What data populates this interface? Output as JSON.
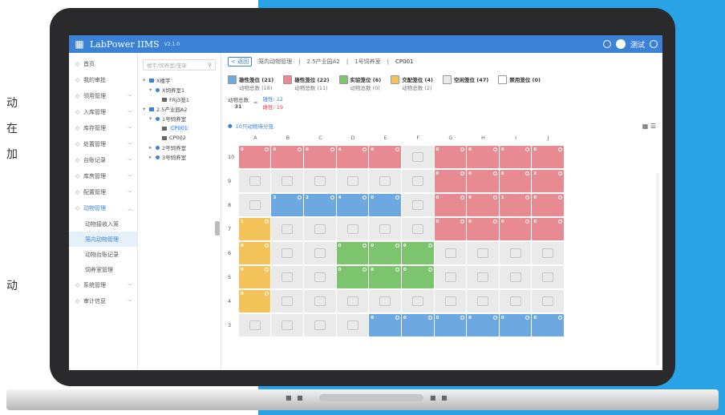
{
  "left_text": [
    "动",
    "在",
    "加",
    "动"
  ],
  "app": {
    "logo": "LabPower IIMS",
    "version": "V2.1.0",
    "user": "测试"
  },
  "sidebar": {
    "items": [
      {
        "icon": "home-icon",
        "label": "首页",
        "expandable": false
      },
      {
        "icon": "approval-icon",
        "label": "我的审批",
        "expandable": false
      },
      {
        "icon": "purchase-icon",
        "label": "领用管理",
        "expandable": true
      },
      {
        "icon": "inbound-icon",
        "label": "入库管理",
        "expandable": true
      },
      {
        "icon": "stock-icon",
        "label": "库存管理",
        "expandable": true
      },
      {
        "icon": "dispose-icon",
        "label": "处置管理",
        "expandable": true
      },
      {
        "icon": "ledger-icon",
        "label": "台账记录",
        "expandable": true
      },
      {
        "icon": "warehouse-icon",
        "label": "库房管理",
        "expandable": true
      },
      {
        "icon": "config-icon",
        "label": "配置管理",
        "expandable": true
      },
      {
        "icon": "animal-icon",
        "label": "动物管理",
        "expandable": true,
        "active": true
      }
    ],
    "subitems": [
      "动物接收入笼",
      "笼内动物管理",
      "动物台账记录",
      "饲养室管理"
    ],
    "selected_sub": 1,
    "items_after": [
      {
        "icon": "system-icon",
        "label": "系统管理",
        "expandable": true
      },
      {
        "icon": "audit-icon",
        "label": "审计信息",
        "expandable": true
      }
    ]
  },
  "tree": {
    "search_placeholder": "楼宇/饲养室/笼架",
    "nodes": [
      {
        "level": 0,
        "label": "X楼宇",
        "twist": "▾",
        "type": "bld"
      },
      {
        "level": 1,
        "label": "X饲养室1",
        "twist": "▾",
        "type": "dot"
      },
      {
        "level": 2,
        "label": "FRJ3笼1",
        "twist": "",
        "type": "sq"
      },
      {
        "level": 0,
        "label": "2.5产业园A2",
        "twist": "▾",
        "type": "bld"
      },
      {
        "level": 1,
        "label": "1号饲养室",
        "twist": "▾",
        "type": "dot"
      },
      {
        "level": 2,
        "label": "CP001",
        "twist": "",
        "type": "sq",
        "selected": true
      },
      {
        "level": 2,
        "label": "CP002",
        "twist": "",
        "type": "sq"
      },
      {
        "level": 1,
        "label": "2号饲养室",
        "twist": "▸",
        "type": "dot"
      },
      {
        "level": 1,
        "label": "3号饲养室",
        "twist": "▸",
        "type": "dot"
      }
    ]
  },
  "breadcrumb": {
    "back": "返回",
    "items": [
      "笼内动物管理",
      "2.5产业园A2",
      "1号饲养室",
      "CP001"
    ]
  },
  "stats": [
    {
      "title": "雄性笼位 (21)",
      "sub": "动物总数 (18)",
      "color": "#6ea8e0"
    },
    {
      "title": "雄性笼位 (22)",
      "sub": "动物总数 (11)",
      "color": "#e88a92"
    },
    {
      "title": "实验笼位 (6)",
      "sub": "动物总数 (0)",
      "color": "#7cc46e"
    },
    {
      "title": "交配笼位 (4)",
      "sub": "动物总数 (2)",
      "color": "#f4c35a"
    },
    {
      "title": "空闲笼位 (47)",
      "sub": "",
      "color": "#eaeaea"
    },
    {
      "title": "禁用笼位 (0)",
      "sub": "",
      "color": "#ffffff"
    }
  ],
  "counts": {
    "total_label": "动物总数",
    "total": "31",
    "male": "雄性: 12",
    "female": "雌性: 19"
  },
  "tip": "10只动物待分笼",
  "columns": [
    "A",
    "B",
    "C",
    "D",
    "E",
    "F",
    "G",
    "H",
    "I",
    "J"
  ],
  "rows": [
    {
      "label": "10",
      "cells": [
        [
          "red",
          "0"
        ],
        [
          "red",
          "0"
        ],
        [
          "red",
          "0"
        ],
        [
          "red",
          "4"
        ],
        [
          "red",
          "0"
        ],
        [
          "empty",
          ""
        ],
        [
          "red",
          "0"
        ],
        [
          "red",
          "0"
        ],
        [
          "red",
          "0"
        ],
        [
          "red",
          "0"
        ]
      ]
    },
    {
      "label": "9",
      "cells": [
        [
          "empty",
          ""
        ],
        [
          "empty",
          ""
        ],
        [
          "empty",
          ""
        ],
        [
          "empty",
          ""
        ],
        [
          "empty",
          ""
        ],
        [
          "empty",
          ""
        ],
        [
          "red",
          "0"
        ],
        [
          "red",
          "0"
        ],
        [
          "red",
          "0"
        ],
        [
          "red",
          "2"
        ]
      ]
    },
    {
      "label": "8",
      "cells": [
        [
          "empty",
          ""
        ],
        [
          "blue",
          "3"
        ],
        [
          "blue",
          "2"
        ],
        [
          "blue",
          "4"
        ],
        [
          "blue",
          "0"
        ],
        [
          "empty",
          ""
        ],
        [
          "red",
          "0"
        ],
        [
          "red",
          "0"
        ],
        [
          "red",
          "1"
        ],
        [
          "red",
          "0"
        ]
      ]
    },
    {
      "label": "7",
      "cells": [
        [
          "yellow",
          "1"
        ],
        [
          "empty",
          ""
        ],
        [
          "empty",
          ""
        ],
        [
          "empty",
          ""
        ],
        [
          "empty",
          ""
        ],
        [
          "empty",
          ""
        ],
        [
          "red",
          "0"
        ],
        [
          "red",
          "0"
        ],
        [
          "red",
          "0"
        ],
        [
          "red",
          "0"
        ]
      ]
    },
    {
      "label": "6",
      "cells": [
        [
          "yellow",
          "0"
        ],
        [
          "empty",
          ""
        ],
        [
          "empty",
          ""
        ],
        [
          "green",
          "0"
        ],
        [
          "green",
          "0"
        ],
        [
          "green",
          "0"
        ],
        [
          "empty",
          ""
        ],
        [
          "empty",
          ""
        ],
        [
          "empty",
          ""
        ],
        [
          "empty",
          ""
        ]
      ]
    },
    {
      "label": "5",
      "cells": [
        [
          "yellow",
          "0"
        ],
        [
          "empty",
          ""
        ],
        [
          "empty",
          ""
        ],
        [
          "green",
          "0"
        ],
        [
          "green",
          "0"
        ],
        [
          "green",
          "0"
        ],
        [
          "empty",
          ""
        ],
        [
          "empty",
          ""
        ],
        [
          "empty",
          ""
        ],
        [
          "empty",
          ""
        ]
      ]
    },
    {
      "label": "4",
      "cells": [
        [
          "yellow",
          "0"
        ],
        [
          "empty",
          ""
        ],
        [
          "empty",
          ""
        ],
        [
          "empty",
          ""
        ],
        [
          "empty",
          ""
        ],
        [
          "empty",
          ""
        ],
        [
          "empty",
          ""
        ],
        [
          "empty",
          ""
        ],
        [
          "empty",
          ""
        ],
        [
          "empty",
          ""
        ]
      ]
    },
    {
      "label": "3",
      "cells": [
        [
          "empty",
          ""
        ],
        [
          "empty",
          ""
        ],
        [
          "empty",
          ""
        ],
        [
          "empty",
          ""
        ],
        [
          "blue",
          "0"
        ],
        [
          "blue",
          "0"
        ],
        [
          "blue",
          "0"
        ],
        [
          "blue",
          "0"
        ],
        [
          "blue",
          "0"
        ],
        [
          "blue",
          "0"
        ]
      ]
    }
  ]
}
